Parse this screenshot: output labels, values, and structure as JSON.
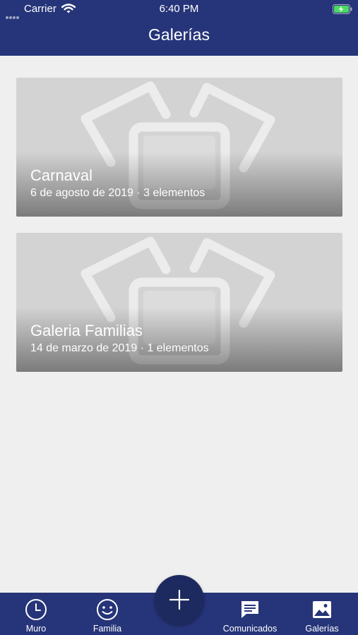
{
  "status_bar": {
    "carrier": "Carrier",
    "time": "6:40 PM",
    "icons": [
      "signal-dots-icon",
      "wifi-icon",
      "battery-charging-icon"
    ]
  },
  "header": {
    "title": "Galerías"
  },
  "galleries": [
    {
      "name": "Carnaval",
      "meta": "6 de agosto de 2019 · 3 elementos",
      "image": "photos-placeholder-icon"
    },
    {
      "name": "Galeria Familias",
      "meta": "14 de marzo de 2019 · 1 elementos",
      "image": "photos-placeholder-icon"
    }
  ],
  "fab": {
    "icon": "plus-icon"
  },
  "tabbar": {
    "items": [
      {
        "label": "Muro",
        "icon": "clock-icon"
      },
      {
        "label": "Familia",
        "icon": "smiley-icon"
      },
      {
        "label": "Comunicados",
        "icon": "chat-bubble-icon"
      },
      {
        "label": "Galerías",
        "icon": "image-icon"
      }
    ]
  },
  "colors": {
    "primary": "#263579",
    "fab": "#1d2a5f",
    "background": "#efefef",
    "card_placeholder": "#d3d3d3",
    "battery": "#4cd964"
  }
}
